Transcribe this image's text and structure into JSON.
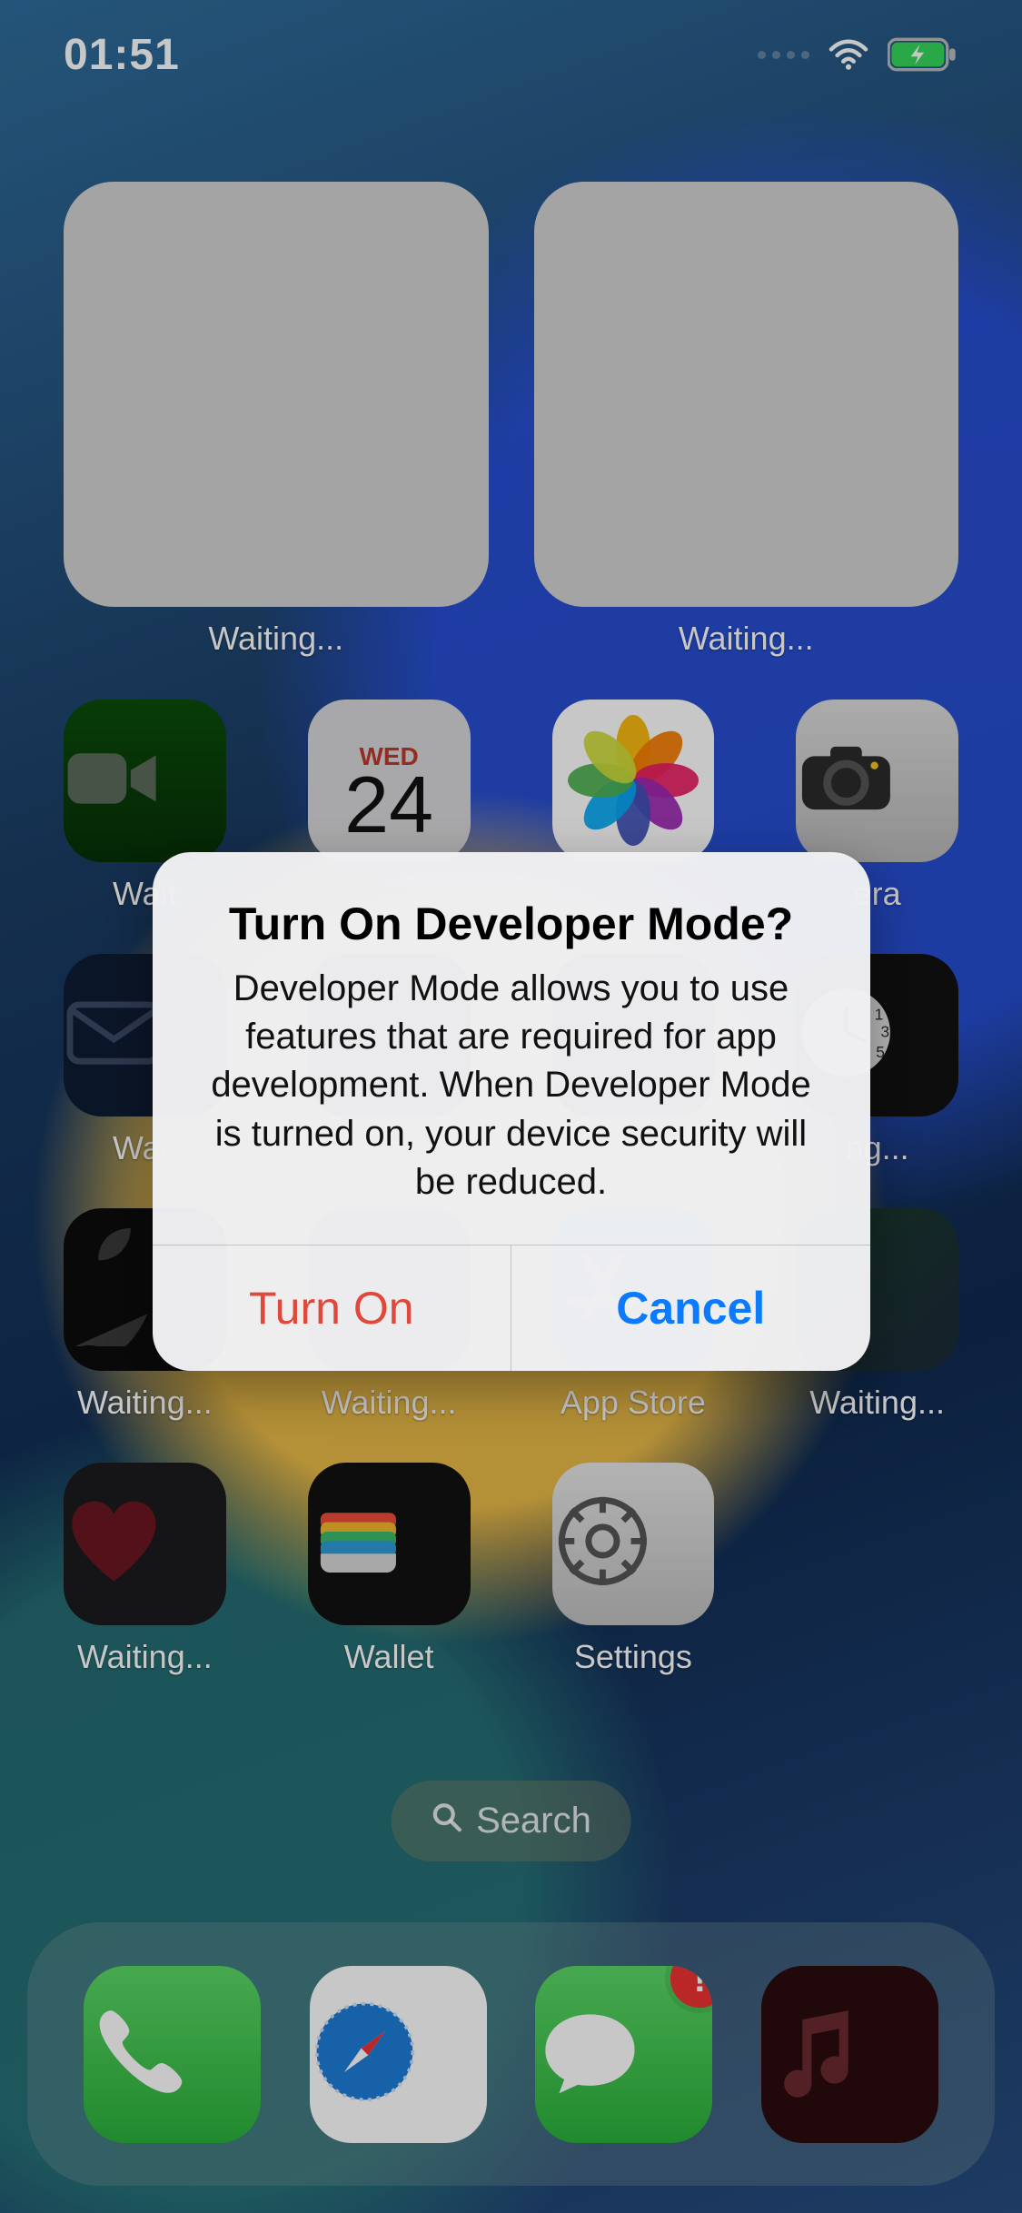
{
  "status": {
    "time": "01:51",
    "charging": true
  },
  "widgets": [
    {
      "label": "Waiting..."
    },
    {
      "label": "Waiting..."
    }
  ],
  "calendar": {
    "weekday": "WED",
    "day": "24"
  },
  "rows": {
    "r1": [
      {
        "name": "facetime",
        "label": "Wait"
      },
      {
        "name": "calendar",
        "label": ""
      },
      {
        "name": "photos",
        "label": ""
      },
      {
        "name": "camera",
        "label": "era"
      }
    ],
    "r2": [
      {
        "name": "mail",
        "label": "Wait"
      },
      {
        "name": "blank1",
        "label": ""
      },
      {
        "name": "blank2",
        "label": ""
      },
      {
        "name": "clock",
        "label": "ng..."
      }
    ],
    "r3": [
      {
        "name": "tv",
        "label": "Waiting..."
      },
      {
        "name": "podcasts",
        "label": "Waiting..."
      },
      {
        "name": "appstore",
        "label": "App Store"
      },
      {
        "name": "maps",
        "label": "Waiting..."
      }
    ],
    "r4": [
      {
        "name": "health",
        "label": "Waiting..."
      },
      {
        "name": "wallet",
        "label": "Wallet"
      },
      {
        "name": "settings",
        "label": "Settings"
      }
    ]
  },
  "search_label": "Search",
  "dock": [
    {
      "name": "phone",
      "label": ""
    },
    {
      "name": "safari",
      "label": ""
    },
    {
      "name": "messages",
      "label": "",
      "badge": "!"
    },
    {
      "name": "music",
      "label": ""
    }
  ],
  "alert": {
    "title": "Turn On Developer Mode?",
    "message": "Developer Mode allows you to use features that are required for app development. When Developer Mode is turned on, your device security will be reduced.",
    "primary": "Turn On",
    "secondary": "Cancel"
  }
}
